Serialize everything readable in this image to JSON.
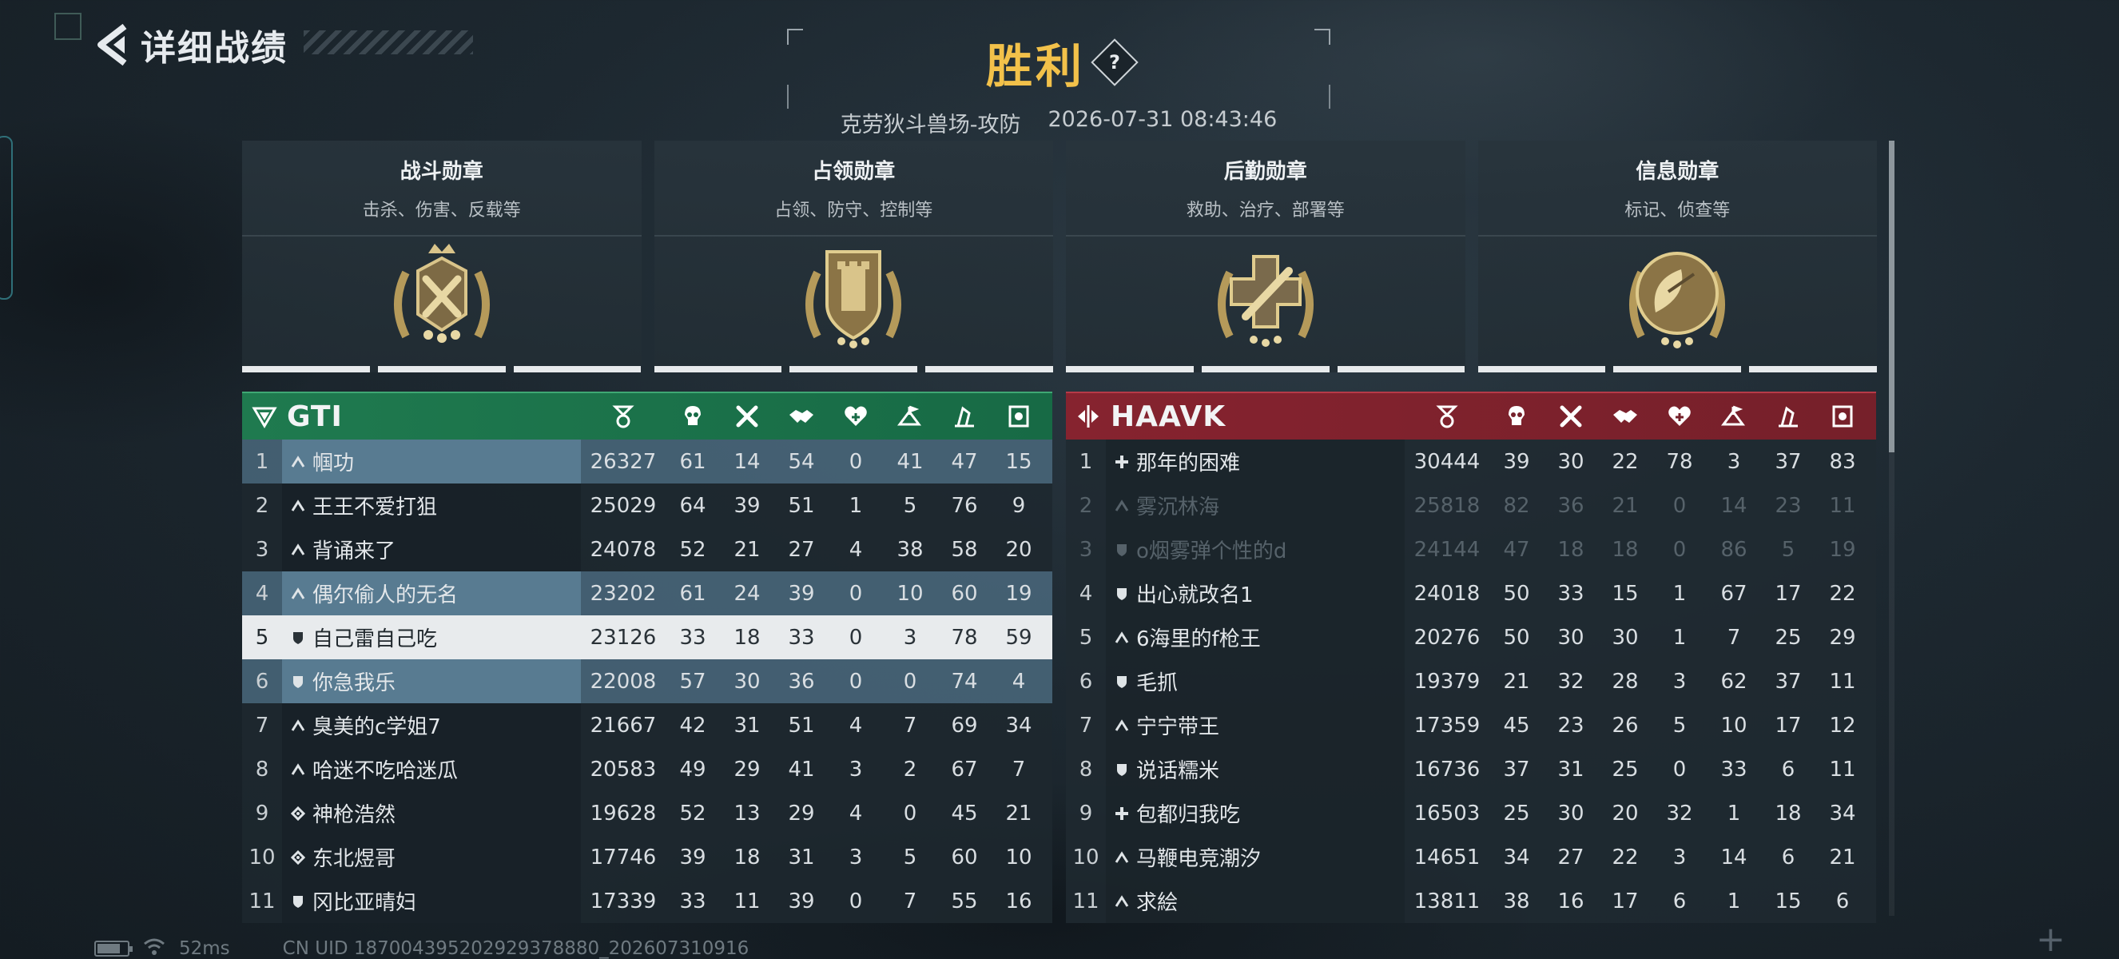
{
  "header": {
    "title": "详细战绩",
    "result": "胜利",
    "help_label": "?",
    "map_mode": "克劳狄斗兽场-攻防",
    "datetime": "2026-07-31 08:43:46"
  },
  "medals": [
    {
      "name": "战斗勋章",
      "desc": "击杀、伤害、反载等",
      "icon": "crossed-swords-medal-icon"
    },
    {
      "name": "占领勋章",
      "desc": "占领、防守、控制等",
      "icon": "shield-fortress-medal-icon"
    },
    {
      "name": "后勤勋章",
      "desc": "救助、治疗、部署等",
      "icon": "medical-cross-medal-icon"
    },
    {
      "name": "信息勋章",
      "desc": "标记、侦查等",
      "icon": "radar-dish-medal-icon"
    }
  ],
  "columns": [
    "score-icon",
    "kills-icon",
    "deaths-icon",
    "assists-icon",
    "revives-icon",
    "captures-icon",
    "logistics-icon",
    "intel-icon"
  ],
  "teams": {
    "gti": {
      "name": "GTI",
      "color": "#1f7a4f",
      "rows": [
        {
          "rank": "1",
          "class": "assault",
          "name": "帼功",
          "score": "26327",
          "stats": [
            "61",
            "14",
            "54",
            "0",
            "41",
            "47",
            "15"
          ],
          "state": "hl"
        },
        {
          "rank": "2",
          "class": "assault",
          "name": "王王不爱打狙",
          "score": "25029",
          "stats": [
            "64",
            "39",
            "51",
            "1",
            "5",
            "76",
            "9"
          ],
          "state": ""
        },
        {
          "rank": "3",
          "class": "assault",
          "name": "背诵来了",
          "score": "24078",
          "stats": [
            "52",
            "21",
            "27",
            "4",
            "38",
            "58",
            "20"
          ],
          "state": ""
        },
        {
          "rank": "4",
          "class": "assault",
          "name": "偶尔偷人的无名",
          "score": "23202",
          "stats": [
            "61",
            "24",
            "39",
            "0",
            "10",
            "60",
            "19"
          ],
          "state": "hl"
        },
        {
          "rank": "5",
          "class": "engineer",
          "name": "自己雷自己吃",
          "score": "23126",
          "stats": [
            "33",
            "18",
            "33",
            "0",
            "3",
            "78",
            "59"
          ],
          "state": "self"
        },
        {
          "rank": "6",
          "class": "engineer",
          "name": "你急我乐",
          "score": "22008",
          "stats": [
            "57",
            "30",
            "36",
            "0",
            "0",
            "74",
            "4"
          ],
          "state": "hl"
        },
        {
          "rank": "7",
          "class": "assault",
          "name": "臭美的c学姐7",
          "score": "21667",
          "stats": [
            "42",
            "31",
            "51",
            "4",
            "7",
            "69",
            "34"
          ],
          "state": ""
        },
        {
          "rank": "8",
          "class": "assault",
          "name": "哈迷不吃哈迷瓜",
          "score": "20583",
          "stats": [
            "49",
            "29",
            "41",
            "3",
            "2",
            "67",
            "7"
          ],
          "state": ""
        },
        {
          "rank": "9",
          "class": "recon",
          "name": "神枪浩然",
          "score": "19628",
          "stats": [
            "52",
            "13",
            "29",
            "4",
            "0",
            "45",
            "21"
          ],
          "state": ""
        },
        {
          "rank": "10",
          "class": "recon",
          "name": "东北煜哥",
          "score": "17746",
          "stats": [
            "39",
            "18",
            "31",
            "3",
            "5",
            "60",
            "10"
          ],
          "state": ""
        },
        {
          "rank": "11",
          "class": "engineer",
          "name": "冈比亚晴妇",
          "score": "17339",
          "stats": [
            "33",
            "11",
            "39",
            "0",
            "7",
            "55",
            "16"
          ],
          "state": ""
        }
      ]
    },
    "haavk": {
      "name": "HAAVK",
      "color": "#86232f",
      "rows": [
        {
          "rank": "1",
          "class": "medic",
          "name": "那年的困难",
          "score": "30444",
          "stats": [
            "39",
            "30",
            "22",
            "78",
            "3",
            "37",
            "83"
          ],
          "state": ""
        },
        {
          "rank": "2",
          "class": "assault",
          "name": "雾沉林海",
          "score": "25818",
          "stats": [
            "82",
            "36",
            "21",
            "0",
            "14",
            "23",
            "11"
          ],
          "state": "dim"
        },
        {
          "rank": "3",
          "class": "engineer",
          "name": "o烟雾弹个性的d",
          "score": "24144",
          "stats": [
            "47",
            "18",
            "18",
            "0",
            "86",
            "5",
            "19"
          ],
          "state": "dim"
        },
        {
          "rank": "4",
          "class": "engineer",
          "name": "出心就改名1",
          "score": "24018",
          "stats": [
            "50",
            "33",
            "15",
            "1",
            "67",
            "17",
            "22"
          ],
          "state": ""
        },
        {
          "rank": "5",
          "class": "assault",
          "name": "6海里的f枪王",
          "score": "20276",
          "stats": [
            "50",
            "30",
            "30",
            "1",
            "7",
            "25",
            "29"
          ],
          "state": ""
        },
        {
          "rank": "6",
          "class": "engineer",
          "name": "毛抓",
          "score": "19379",
          "stats": [
            "21",
            "32",
            "28",
            "3",
            "62",
            "37",
            "11"
          ],
          "state": ""
        },
        {
          "rank": "7",
          "class": "assault",
          "name": "宁宁带王",
          "score": "17359",
          "stats": [
            "45",
            "23",
            "26",
            "5",
            "10",
            "17",
            "12"
          ],
          "state": ""
        },
        {
          "rank": "8",
          "class": "engineer",
          "name": "说话糯米",
          "score": "16736",
          "stats": [
            "37",
            "31",
            "25",
            "0",
            "33",
            "6",
            "11"
          ],
          "state": ""
        },
        {
          "rank": "9",
          "class": "medic",
          "name": "包都归我吃",
          "score": "16503",
          "stats": [
            "25",
            "30",
            "20",
            "32",
            "1",
            "18",
            "34"
          ],
          "state": ""
        },
        {
          "rank": "10",
          "class": "assault",
          "name": "马鞭电竞潮汐",
          "score": "14651",
          "stats": [
            "34",
            "27",
            "22",
            "3",
            "14",
            "6",
            "21"
          ],
          "state": ""
        },
        {
          "rank": "11",
          "class": "assault",
          "name": "求絵",
          "score": "13811",
          "stats": [
            "38",
            "16",
            "17",
            "6",
            "1",
            "15",
            "6"
          ],
          "state": ""
        }
      ]
    }
  },
  "footer": {
    "ping": "52ms",
    "uid": "CN UID 187004395202929378880_202607310916"
  }
}
